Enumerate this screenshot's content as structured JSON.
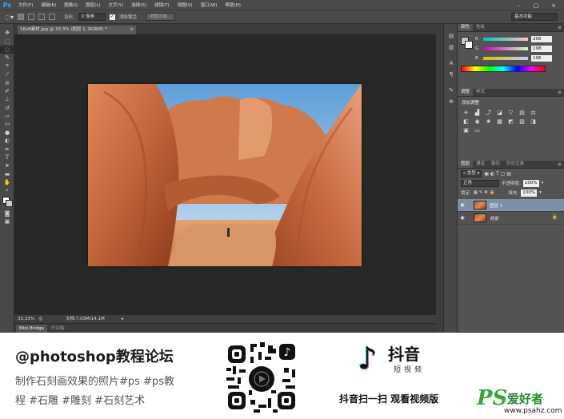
{
  "app": {
    "logo": "Ps",
    "menu": [
      "文件(F)",
      "编辑(E)",
      "图像(I)",
      "图层(L)",
      "文字(Y)",
      "选择(S)",
      "滤镜(T)",
      "视图(V)",
      "窗口(W)",
      "帮助(H)"
    ],
    "window_controls": [
      "–",
      "□",
      "×"
    ]
  },
  "options_bar": {
    "feather_label": "羽化:",
    "feather_value": "0 像素",
    "antialias_label": "消除锯齿",
    "refine_edge_button": "调整边缘...",
    "workspace": "基本功能"
  },
  "tools": [
    "move-icon",
    "marquee-icon",
    "lasso-icon",
    "quick-select-icon",
    "crop-icon",
    "eyedropper-icon",
    "healing-icon",
    "brush-icon",
    "stamp-icon",
    "history-brush-icon",
    "eraser-icon",
    "gradient-icon",
    "blur-icon",
    "dodge-icon",
    "pen-icon",
    "type-icon",
    "path-select-icon",
    "shape-icon",
    "hand-icon",
    "zoom-icon",
    "color-swatches",
    "quick-mask-icon",
    "screen-mode-icon"
  ],
  "document": {
    "tab_title": "16x8素材.jpg @ 33.3% (图层 1, RGB/8) *",
    "zoom": "33.33%",
    "doc_size": "文档:7.03M/14.1M"
  },
  "bottom_tabs": [
    "Mini Bridge",
    "时间轴"
  ],
  "color_panel": {
    "tabs": [
      "颜色",
      "色板"
    ],
    "channels": [
      {
        "name": "R",
        "value": "206"
      },
      {
        "name": "G",
        "value": "198"
      },
      {
        "name": "B",
        "value": "196"
      }
    ]
  },
  "adjustments_panel": {
    "tabs": [
      "调整",
      "样式"
    ],
    "heading": "添加调整"
  },
  "layers_panel": {
    "tabs": [
      "图层",
      "通道",
      "路径",
      "历史记录"
    ],
    "filter": "类型",
    "blend_mode": "正常",
    "opacity_label": "不透明度:",
    "opacity": "100%",
    "lock_label": "锁定:",
    "fill_label": "填充:",
    "fill": "100%",
    "layers": [
      {
        "name": "图层 1",
        "active": true,
        "locked": false
      },
      {
        "name": "背景",
        "active": false,
        "locked": true
      }
    ]
  },
  "footer": {
    "title": "@photoshop教程论坛",
    "line1": "制作石刻画效果的照片#ps #ps教",
    "line2": "程 #石雕 #雕刻 #石刻艺术",
    "douyin_name": "抖音",
    "douyin_sub": "短视频",
    "douyin_caption": "抖音扫一扫 观看视频版",
    "watermark_ps": "PS",
    "watermark_cn": "爱好者",
    "watermark_url": "www.psahz.com"
  }
}
